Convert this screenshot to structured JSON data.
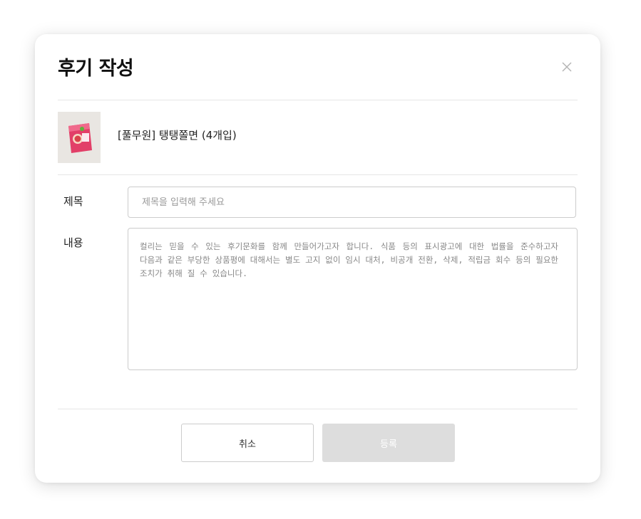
{
  "modal": {
    "title": "후기 작성",
    "close_icon": "close-icon"
  },
  "product": {
    "thumbnail_icon": "product-package-image",
    "name": "[풀무원] 탱탱쫄면 (4개입)"
  },
  "form": {
    "title_label": "제목",
    "title_placeholder": "제목을 입력해 주세요",
    "title_value": "",
    "content_label": "내용",
    "content_placeholder": "컬리는 믿을 수 있는 후기문화를 함께 만들어가고자 합니다. 식품 등의 표시광고에 대한 법률을 준수하고자 다음과 같은 부당한 상품평에 대해서는 별도 고지 없이 임시 대처, 비공개 전환, 삭제, 적립금 회수 등의 필요한 조치가 취해 질 수 있습니다."
  },
  "buttons": {
    "cancel_label": "취소",
    "submit_label": "등록"
  },
  "colors": {
    "title_text": "#111111",
    "divider": "#e6e6e6",
    "input_border": "#cccccc",
    "placeholder": "#999999",
    "submit_disabled_bg": "#dddddd",
    "submit_disabled_text": "#ffffff"
  }
}
